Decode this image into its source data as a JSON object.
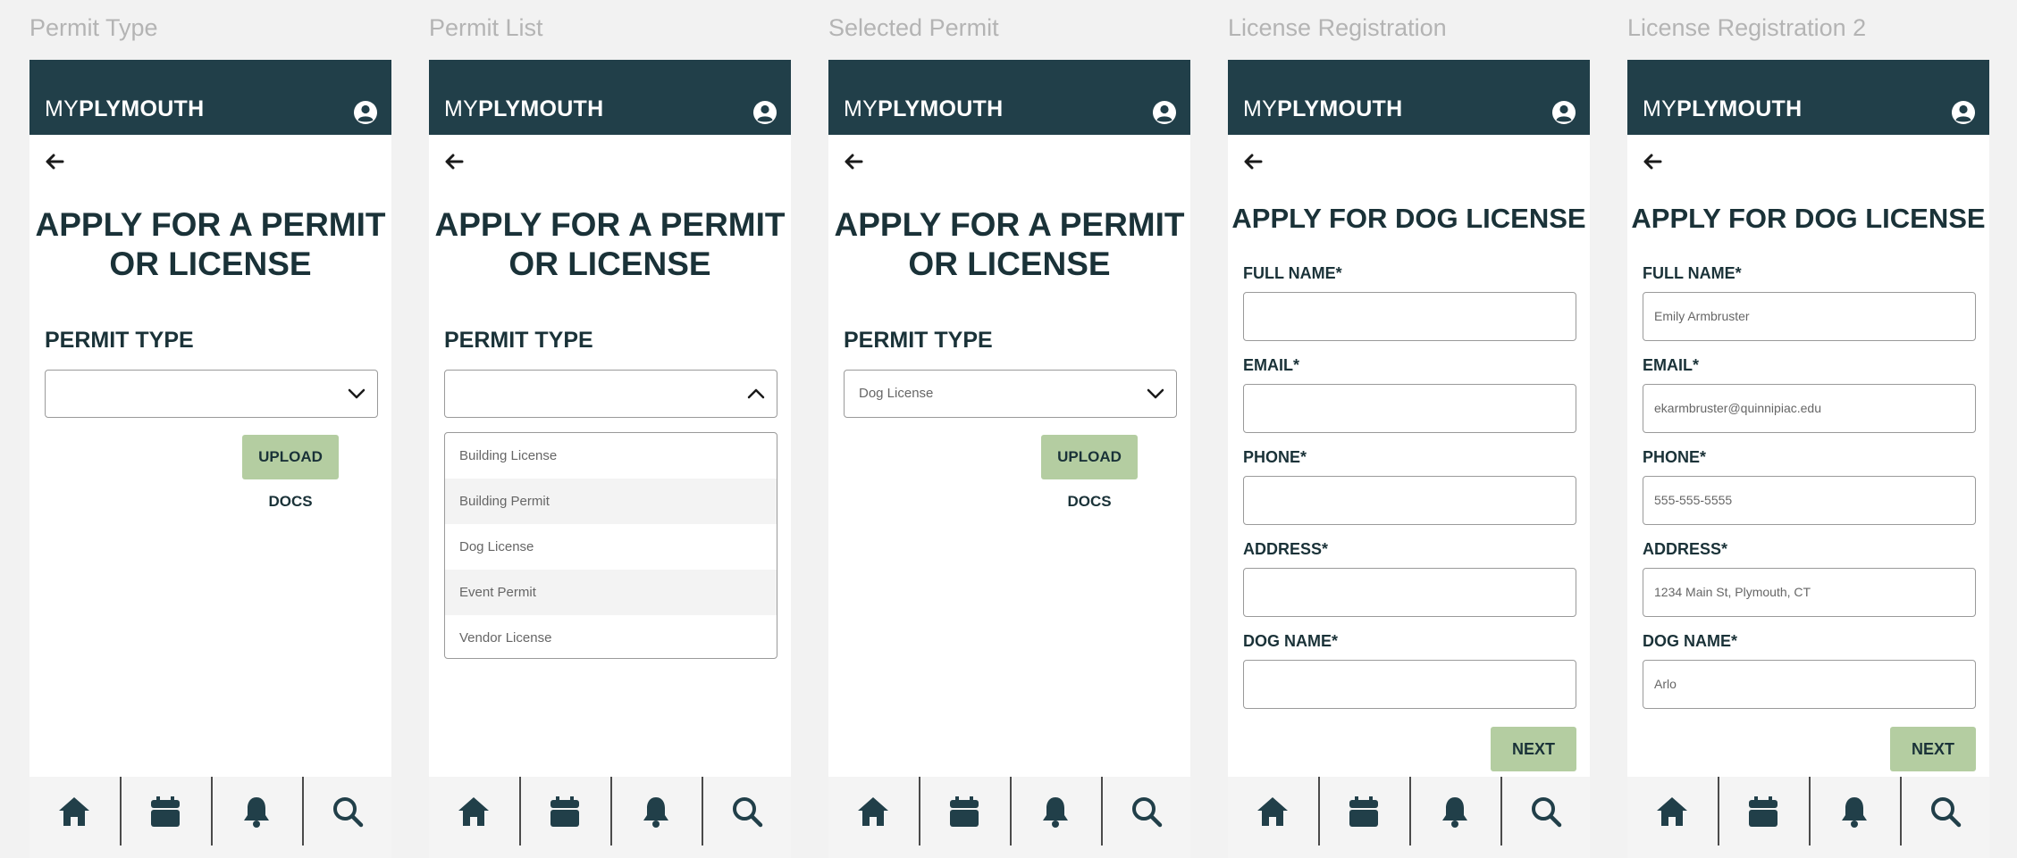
{
  "colors": {
    "header_bg": "#213f49",
    "heading_text": "#1a3238",
    "button_bg": "#b4cda1",
    "frame_title": "#b4b4b4"
  },
  "app": {
    "logo_light": "MY",
    "logo_bold": "PLYMOUTH"
  },
  "icons": {
    "profile": "user-circle-icon",
    "back": "arrow-left-icon",
    "tabs": [
      "home-icon",
      "calendar-icon",
      "bell-icon",
      "search-icon"
    ]
  },
  "screens": [
    {
      "frame_title": "Permit Type",
      "heading": "APPLY FOR A PERMIT OR LICENSE",
      "permit_type_label": "PERMIT TYPE",
      "selected_value": "",
      "dropdown_open": false,
      "upload_label": "UPLOAD DOCS"
    },
    {
      "frame_title": "Permit List",
      "heading": "APPLY FOR A PERMIT OR LICENSE",
      "permit_type_label": "PERMIT TYPE",
      "selected_value": "",
      "dropdown_open": true,
      "options": [
        "Building License",
        "Building Permit",
        "Dog License",
        "Event Permit",
        "Vendor License"
      ]
    },
    {
      "frame_title": "Selected Permit",
      "heading": "APPLY FOR A PERMIT OR LICENSE",
      "permit_type_label": "PERMIT TYPE",
      "selected_value": "Dog License",
      "dropdown_open": false,
      "upload_label": "UPLOAD DOCS"
    },
    {
      "frame_title": "License Registration",
      "heading": "APPLY FOR DOG LICENSE",
      "fields": [
        {
          "label": "FULL NAME*",
          "value": ""
        },
        {
          "label": "EMAIL*",
          "value": ""
        },
        {
          "label": "PHONE*",
          "value": ""
        },
        {
          "label": "ADDRESS*",
          "value": ""
        },
        {
          "label": "DOG NAME*",
          "value": ""
        }
      ],
      "next_label": "NEXT"
    },
    {
      "frame_title": "License Registration 2",
      "heading": "APPLY FOR DOG LICENSE",
      "fields": [
        {
          "label": "FULL NAME*",
          "value": "Emily Armbruster"
        },
        {
          "label": "EMAIL*",
          "value": "ekarmbruster@quinnipiac.edu"
        },
        {
          "label": "PHONE*",
          "value": "555-555-5555"
        },
        {
          "label": "ADDRESS*",
          "value": "1234 Main St, Plymouth, CT"
        },
        {
          "label": "DOG NAME*",
          "value": "Arlo"
        }
      ],
      "next_label": "NEXT"
    }
  ]
}
